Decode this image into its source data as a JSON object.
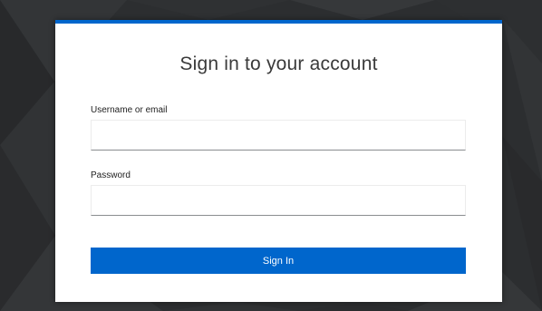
{
  "login": {
    "title": "Sign in to your account",
    "username_label": "Username or email",
    "username_value": "",
    "password_label": "Password",
    "password_value": "",
    "submit_label": "Sign In"
  },
  "colors": {
    "accent": "#0066cc",
    "background": "#2b2d2f",
    "card": "#ffffff"
  }
}
